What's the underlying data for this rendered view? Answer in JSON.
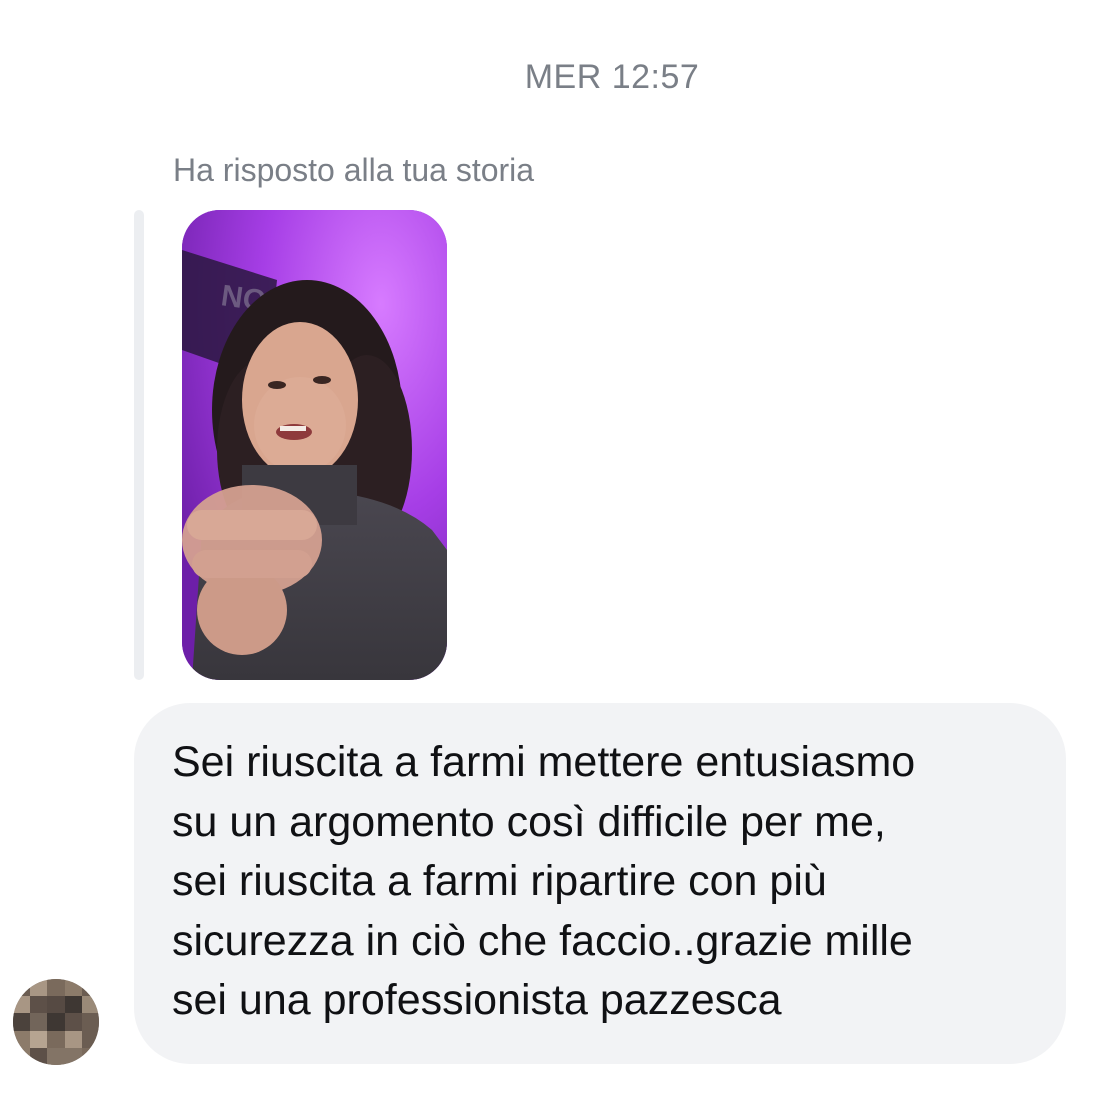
{
  "thread": {
    "timestamp": "MER 12:57",
    "story_reply_label": "Ha risposto alla tua storia",
    "story_thumbnail": {
      "description_icon": "story-video-thumbnail"
    },
    "message": {
      "text": "Sei riuscita a farmi mettere entusiasmo\nsu un argomento così difficile per me,\nsei riuscita a farmi ripartire con più\nsicurezza in ciò che faccio..grazie mille\nsei una professionista pazzesca"
    },
    "sender_avatar": {
      "icon": "pixelated-avatar"
    }
  },
  "colors": {
    "background": "#ffffff",
    "meta_text": "#7a7f87",
    "bubble_bg": "#f2f3f5",
    "bubble_text": "#101114",
    "quote_bar": "#eceef1",
    "story_purple": "#b44cff"
  }
}
